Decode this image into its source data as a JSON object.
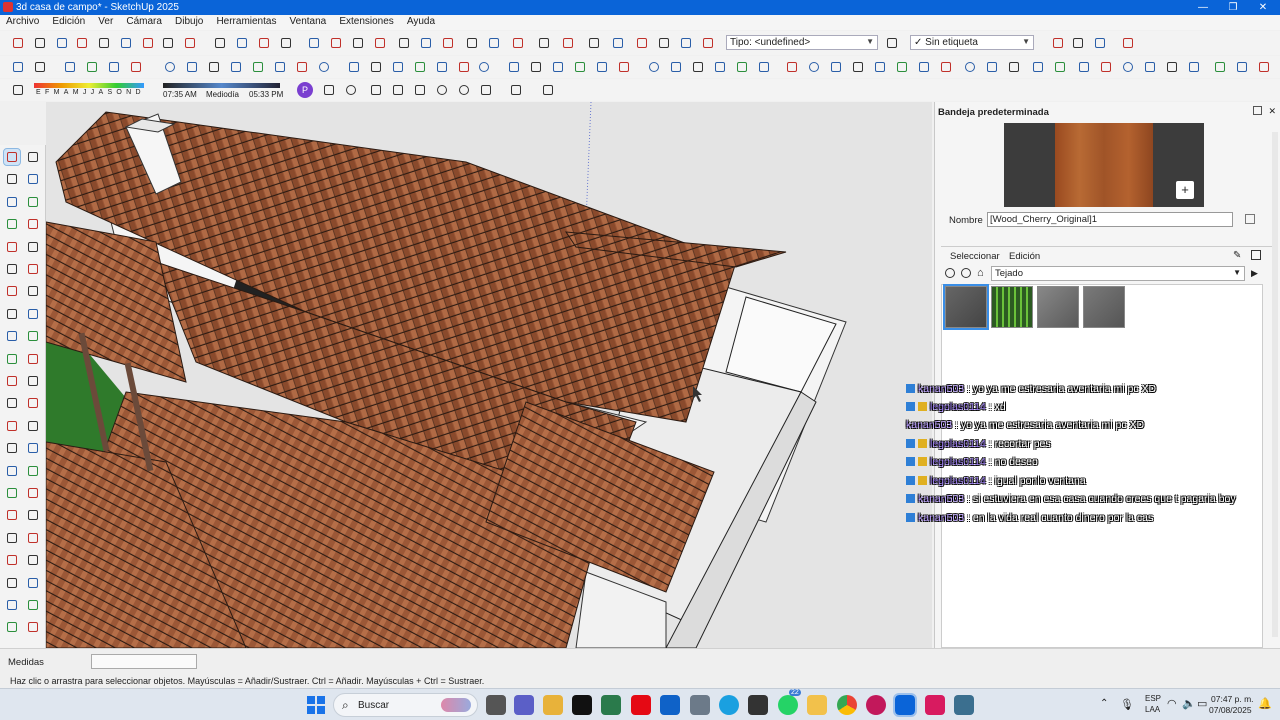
{
  "window": {
    "title": "3d casa de campo* - SketchUp 2025"
  },
  "menu": [
    "Archivo",
    "Edición",
    "Ver",
    "Cámara",
    "Dibujo",
    "Herramientas",
    "Ventana",
    "Extensiones",
    "Ayuda"
  ],
  "toolbar": {
    "tag_label": "Tipo: <undefined>",
    "layer_label": "Sin etiqueta",
    "months": [
      "E",
      "F",
      "M",
      "A",
      "M",
      "J",
      "J",
      "A",
      "S",
      "O",
      "N",
      "D"
    ],
    "time_start": "07:35 AM",
    "time_mid": "Mediodía",
    "time_end": "05:33 PM"
  },
  "tray": {
    "title": "Bandeja predeterminada",
    "name_label": "Nombre",
    "name_value": "[Wood_Cherry_Original]1",
    "tab_select": "Seleccionar",
    "tab_edit": "Edición",
    "collection": "Tejado"
  },
  "chat": [
    {
      "user": "kanan503",
      "msg": "yo ya me estresaria aventaria mi pc XD"
    },
    {
      "user": "legolas0114",
      "msg": "xd"
    },
    {
      "user": "kanan503",
      "msg": "yo ya me estresaria aventaria mi pc XD"
    },
    {
      "user": "legolas0114",
      "msg": "recortar pes"
    },
    {
      "user": "legolas0114",
      "msg": "no deseo"
    },
    {
      "user": "legolas0114",
      "msg": "igual ponlo ventana"
    },
    {
      "user": "kanan503",
      "msg": "si estuviera en esa casa cuando crees que t pagaria boy"
    },
    {
      "user": "kanan503",
      "msg": "en la vida real cuanto dinero por la cas"
    }
  ],
  "status": {
    "measures_label": "Medidas",
    "hint": "Haz clic o arrastra para seleccionar objetos. Mayúsculas = Añadir/Sustraer. Ctrl = Añadir. Mayúsculas + Ctrl = Sustraer."
  },
  "taskbar": {
    "search": "Buscar",
    "lang1": "ESP",
    "lang2": "LAA",
    "time": "07:47 p. m.",
    "date": "07/08/2025",
    "badge": "22"
  },
  "colors": {
    "titlebar": "#0a64d8",
    "roof": "#8b4a2c",
    "wall": "#f2f2f2",
    "accent_chat_user": "#a37cff"
  }
}
